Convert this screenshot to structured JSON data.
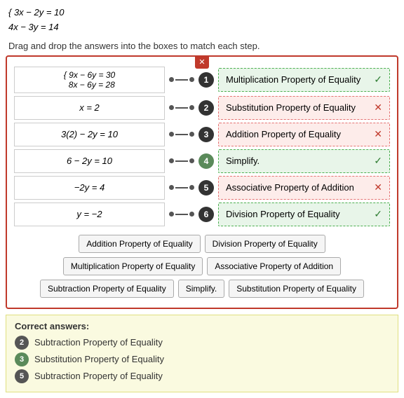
{
  "equations": {
    "line1": "{ 3x − 2y = 10",
    "line2": "  4x − 3y = 14"
  },
  "instruction": "Drag and drop the answers into the boxes to match each step.",
  "close_label": "✕",
  "steps": [
    {
      "id": 1,
      "expr": "{ 9x − 6y = 30   8x − 6y = 28",
      "expr_display": "{ 9x − 6y = 30\n  8x − 6y = 28",
      "answer": "Multiplication Property of Equality",
      "status": "correct",
      "num_style": "dark"
    },
    {
      "id": 2,
      "expr": "x = 2",
      "answer": "Substitution Property of Equality",
      "status": "incorrect",
      "num_style": "dark"
    },
    {
      "id": 3,
      "expr": "3(2) − 2y = 10",
      "answer": "Addition Property of Equality",
      "status": "incorrect",
      "num_style": "dark"
    },
    {
      "id": 4,
      "expr": "6 − 2y = 10",
      "answer": "Simplify.",
      "status": "correct",
      "num_style": "green-bg"
    },
    {
      "id": 5,
      "expr": "−2y = 4",
      "answer": "Associative Property of Addition",
      "status": "incorrect",
      "num_style": "dark"
    },
    {
      "id": 6,
      "expr": "y = −2",
      "answer": "Division Property of Equality",
      "status": "correct",
      "num_style": "dark"
    }
  ],
  "answer_bank": [
    "Addition Property of Equality",
    "Division Property of Equality",
    "Multiplication Property of Equality",
    "Associative Property of Addition",
    "Subtraction Property of Equality",
    "Simplify.",
    "Substitution Property of Equality"
  ],
  "correct_answers": {
    "title": "Correct answers:",
    "items": [
      {
        "num": "2",
        "num_style": "dark",
        "text": "Subtraction Property of Equality"
      },
      {
        "num": "3",
        "num_style": "green-bg",
        "text": "Substitution Property of Equality"
      },
      {
        "num": "5",
        "num_style": "dark",
        "text": "Subtraction Property of Equality"
      }
    ]
  }
}
